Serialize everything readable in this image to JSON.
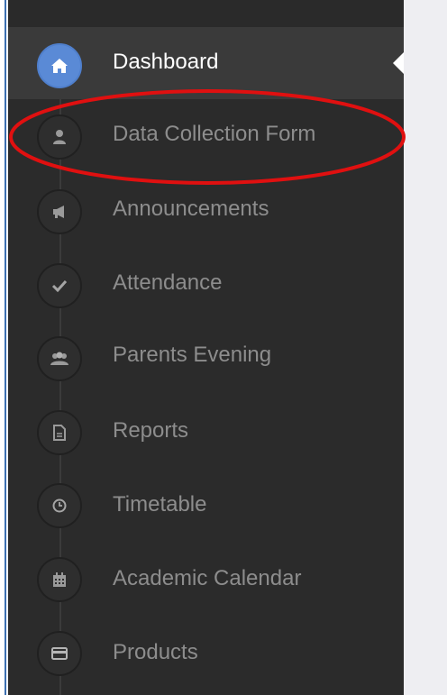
{
  "sidebar": {
    "items": [
      {
        "label": "Dashboard",
        "icon": "home-icon",
        "active": true
      },
      {
        "label": "Data Collection Form",
        "icon": "user-icon",
        "active": false
      },
      {
        "label": "Announcements",
        "icon": "megaphone-icon",
        "active": false
      },
      {
        "label": "Attendance",
        "icon": "check-icon",
        "active": false
      },
      {
        "label": "Parents Evening",
        "icon": "users-icon",
        "active": false
      },
      {
        "label": "Reports",
        "icon": "document-icon",
        "active": false
      },
      {
        "label": "Timetable",
        "icon": "clock-icon",
        "active": false
      },
      {
        "label": "Academic Calendar",
        "icon": "calendar-icon",
        "active": false
      },
      {
        "label": "Products",
        "icon": "credit-card-icon",
        "active": false
      }
    ]
  },
  "colors": {
    "sidebar_bg": "#2b2b2b",
    "active_bg": "#3a3a3a",
    "active_icon_bg": "#5a8ad6",
    "highlight": "#e01010",
    "content_bg": "#eeeef2"
  }
}
